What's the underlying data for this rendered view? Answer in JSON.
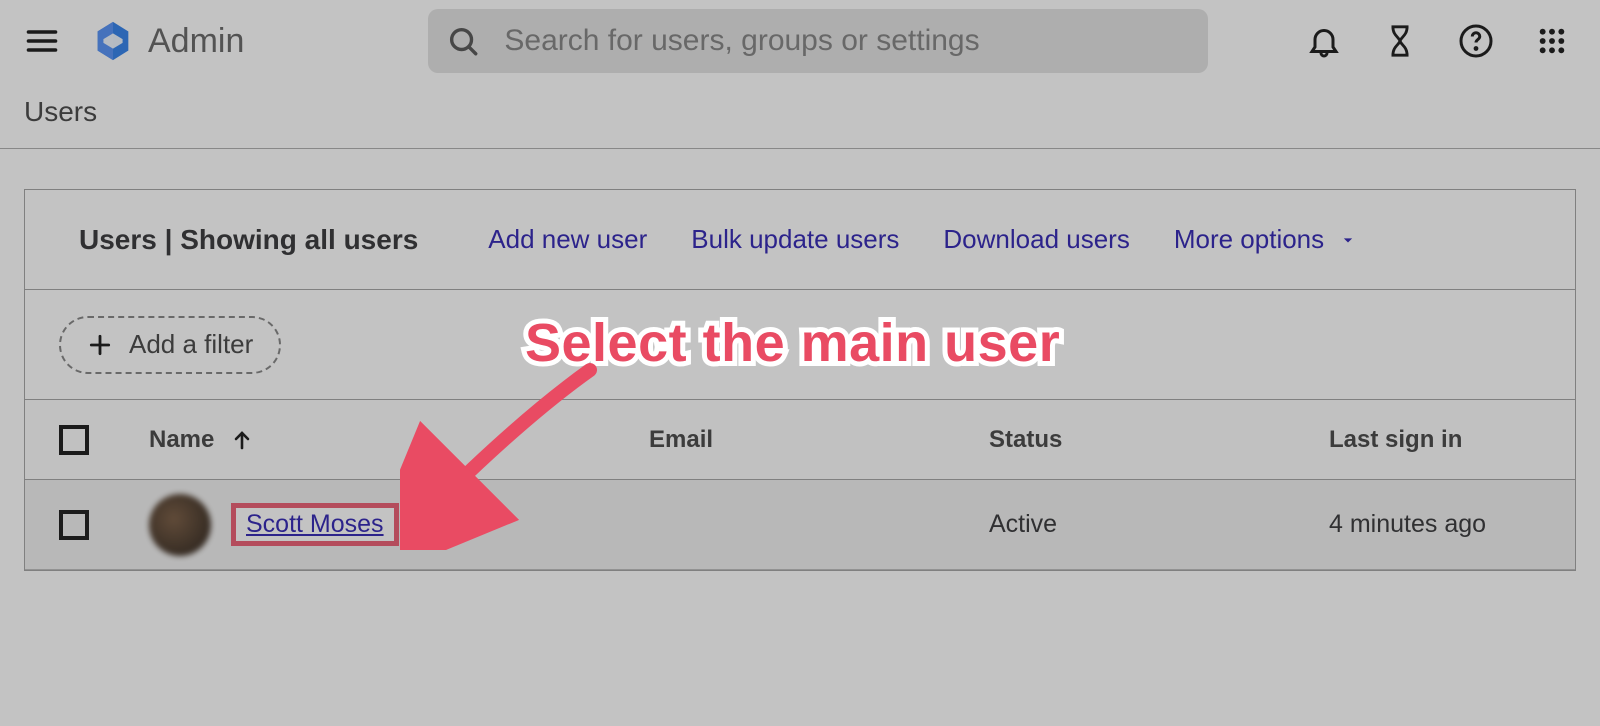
{
  "header": {
    "brand": "Admin",
    "search_placeholder": "Search for users, groups or settings"
  },
  "breadcrumb": "Users",
  "panel": {
    "title": "Users | Showing all users",
    "actions": {
      "add_new_user": "Add new user",
      "bulk_update": "Bulk update users",
      "download": "Download users",
      "more_options": "More options"
    },
    "add_filter": "Add a filter",
    "columns": {
      "name": "Name",
      "email": "Email",
      "status": "Status",
      "last_sign_in": "Last sign in"
    },
    "rows": [
      {
        "name": "Scott Moses",
        "status": "Active",
        "last_sign_in": "4 minutes ago"
      }
    ]
  },
  "annotation": {
    "text": "Select the main user"
  }
}
